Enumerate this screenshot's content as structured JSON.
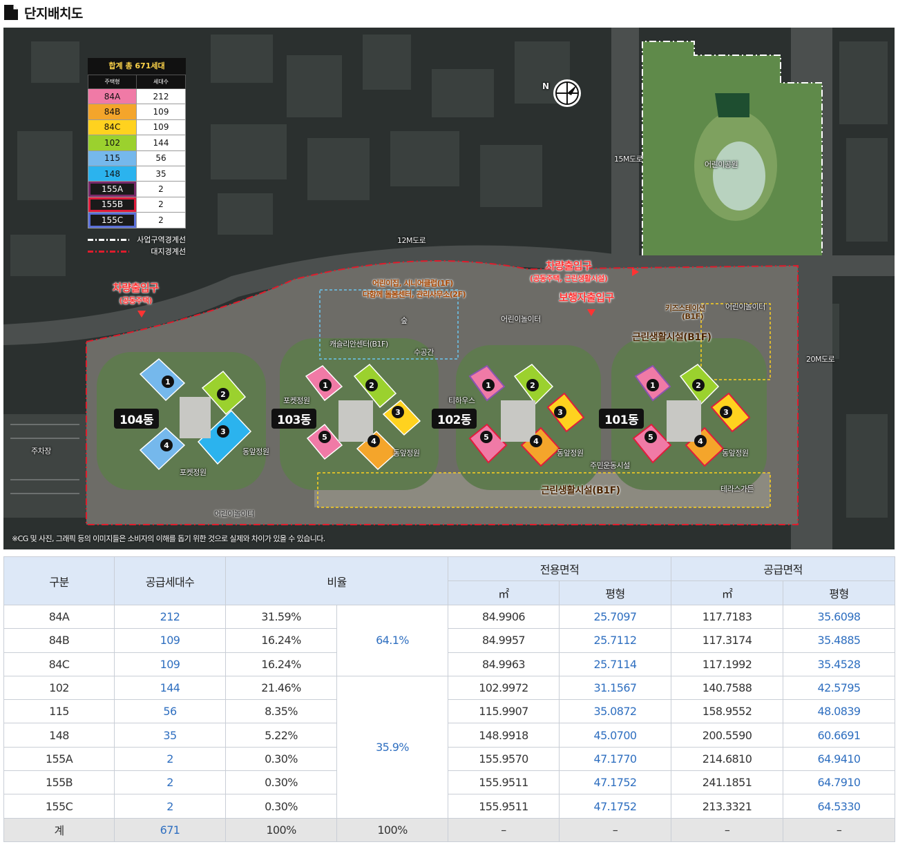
{
  "page": {
    "title": "단지배치도"
  },
  "map": {
    "legend": {
      "title": "합계 총 671세대",
      "col_type": "주택형",
      "col_units": "세대수",
      "rows": [
        {
          "type": "84A",
          "units": "212",
          "color": "#f07aa6"
        },
        {
          "type": "84B",
          "units": "109",
          "color": "#f4a52b"
        },
        {
          "type": "84C",
          "units": "109",
          "color": "#ffd21f"
        },
        {
          "type": "102",
          "units": "144",
          "color": "#9bd12e"
        },
        {
          "type": "115",
          "units": "56",
          "color": "#75b8ec"
        },
        {
          "type": "148",
          "units": "35",
          "color": "#2bb3ee"
        },
        {
          "type": "155A",
          "units": "2",
          "color": "#1a1a1a",
          "border": "#7a2a6a"
        },
        {
          "type": "155B",
          "units": "2",
          "color": "#1a1a1a",
          "border": "#e01c3c"
        },
        {
          "type": "155C",
          "units": "2",
          "color": "#1a1a1a",
          "border": "#5a6ed8"
        }
      ],
      "line_business": "사업구역경계선",
      "line_site": "대지경계선"
    },
    "labels": {
      "road_15m": "15M도로",
      "road_12m": "12M도로",
      "road_20m": "20M도로",
      "kids_park": "어린이공원",
      "parking": "주차장",
      "pocket_garden_104": "포켓정원",
      "pocket_garden_103": "포켓정원",
      "front_garden_104": "동앞정원",
      "front_garden_103": "동앞정원",
      "front_garden_102": "동앞정원",
      "front_garden_101": "동앞정원",
      "playground_1": "어린이놀이터",
      "playground_2": "어린이놀이터",
      "playground_3": "어린이놀이터",
      "forest": "숲",
      "water_space": "수공간",
      "tea_house": "티하우스",
      "fitness": "주민운동시설",
      "terrace_garden": "테라스가든"
    },
    "entrances": {
      "vehicle_left": "차량출입구",
      "vehicle_left_sub": "(공동주택)",
      "vehicle_right": "차량출입구",
      "vehicle_right_sub": "(공동주택, 근린생활시설)",
      "pedestrian": "보행자출입구"
    },
    "facilities": {
      "daycare": "어린이집, 시니어클럽(1F)",
      "care_center": "다함께 돌봄센터, 관리사무소(2F)",
      "calligraphy": "캐슬리안센터(B1F)",
      "kids_station": "키즈스테이션",
      "kids_station_floor": "(B1F)",
      "retail_upper": "근린생활시설(B1F)",
      "retail_lower": "근린생활시설(B1F)"
    },
    "buildings": [
      "104동",
      "103동",
      "102동",
      "101동"
    ],
    "compass": "N",
    "disclaimer": "※CG 및 사진, 그래픽 등의 이미지들은 소비자의 이해를 돕기 위한 것으로 실제와 차이가 있을 수 있습니다."
  },
  "table": {
    "headers": {
      "category": "구분",
      "supply_units": "공급세대수",
      "ratio": "비율",
      "exclusive_area": "전용면적",
      "supply_area": "공급면적",
      "sqm": "㎡",
      "pyeong": "평형"
    },
    "rows": [
      {
        "type": "84A",
        "units": "212",
        "ratio": "31.59%",
        "ex_sqm": "84.9906",
        "ex_py": "25.7097",
        "sup_sqm": "117.7183",
        "sup_py": "35.6098"
      },
      {
        "type": "84B",
        "units": "109",
        "ratio": "16.24%",
        "ex_sqm": "84.9957",
        "ex_py": "25.7112",
        "sup_sqm": "117.3174",
        "sup_py": "35.4885"
      },
      {
        "type": "84C",
        "units": "109",
        "ratio": "16.24%",
        "ex_sqm": "84.9963",
        "ex_py": "25.7114",
        "sup_sqm": "117.1992",
        "sup_py": "35.4528"
      },
      {
        "type": "102",
        "units": "144",
        "ratio": "21.46%",
        "ex_sqm": "102.9972",
        "ex_py": "31.1567",
        "sup_sqm": "140.7588",
        "sup_py": "42.5795"
      },
      {
        "type": "115",
        "units": "56",
        "ratio": "8.35%",
        "ex_sqm": "115.9907",
        "ex_py": "35.0872",
        "sup_sqm": "158.9552",
        "sup_py": "48.0839"
      },
      {
        "type": "148",
        "units": "35",
        "ratio": "5.22%",
        "ex_sqm": "148.9918",
        "ex_py": "45.0700",
        "sup_sqm": "200.5590",
        "sup_py": "60.6691"
      },
      {
        "type": "155A",
        "units": "2",
        "ratio": "0.30%",
        "ex_sqm": "155.9570",
        "ex_py": "47.1770",
        "sup_sqm": "214.6810",
        "sup_py": "64.9410"
      },
      {
        "type": "155B",
        "units": "2",
        "ratio": "0.30%",
        "ex_sqm": "155.9511",
        "ex_py": "47.1752",
        "sup_sqm": "241.1851",
        "sup_py": "64.7910"
      },
      {
        "type": "155C",
        "units": "2",
        "ratio": "0.30%",
        "ex_sqm": "155.9511",
        "ex_py": "47.1752",
        "sup_sqm": "213.3321",
        "sup_py": "64.5330"
      }
    ],
    "group_ratio_1": "64.1%",
    "group_ratio_2": "35.9%",
    "total": {
      "label": "계",
      "units": "671",
      "ratio": "100%",
      "group": "100%",
      "ex_sqm": "–",
      "ex_py": "–",
      "sup_sqm": "–",
      "sup_py": "–"
    }
  }
}
